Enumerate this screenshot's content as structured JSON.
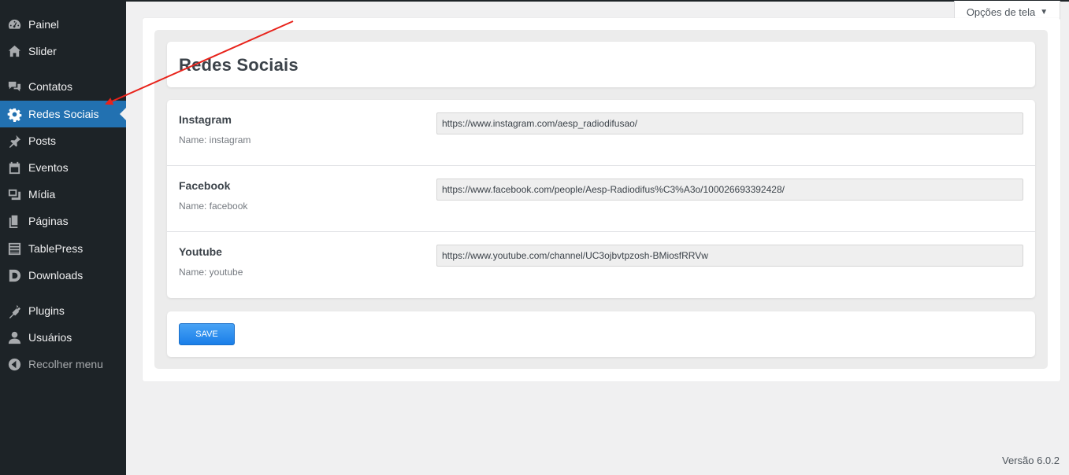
{
  "sidebar": {
    "items": [
      {
        "label": "Painel",
        "icon": "dashboard-icon"
      },
      {
        "label": "Slider",
        "icon": "home-icon"
      },
      {
        "label": "Contatos",
        "icon": "comments-icon"
      },
      {
        "label": "Redes Sociais",
        "icon": "gear-icon",
        "current": true
      },
      {
        "label": "Posts",
        "icon": "pin-icon"
      },
      {
        "label": "Eventos",
        "icon": "calendar-icon"
      },
      {
        "label": "Mídia",
        "icon": "media-icon"
      },
      {
        "label": "Páginas",
        "icon": "pages-icon"
      },
      {
        "label": "TablePress",
        "icon": "table-icon"
      },
      {
        "label": "Downloads",
        "icon": "download-d-icon"
      },
      {
        "label": "Plugins",
        "icon": "plugin-icon"
      },
      {
        "label": "Usuários",
        "icon": "user-icon"
      },
      {
        "label": "Recolher menu",
        "icon": "collapse-icon"
      }
    ]
  },
  "screen_options": {
    "label": "Opções de tela",
    "caret": "▼"
  },
  "page": {
    "title": "Redes Sociais"
  },
  "fields": [
    {
      "label": "Instagram",
      "name_text": "Name: instagram",
      "value": "https://www.instagram.com/aesp_radiodifusao/"
    },
    {
      "label": "Facebook",
      "name_text": "Name: facebook",
      "value": "https://www.facebook.com/people/Aesp-Radiodifus%C3%A3o/100026693392428/"
    },
    {
      "label": "Youtube",
      "name_text": "Name: youtube",
      "value": "https://www.youtube.com/channel/UC3ojbvtpzosh-BMiosfRRVw"
    }
  ],
  "save": {
    "label": "SAVE"
  },
  "footer": {
    "version": "Versão 6.0.2"
  },
  "colors": {
    "sidebar_bg": "#1d2327",
    "accent": "#2271b1",
    "annotation": "#e8231b",
    "save_btn": "#2a8cf0"
  }
}
